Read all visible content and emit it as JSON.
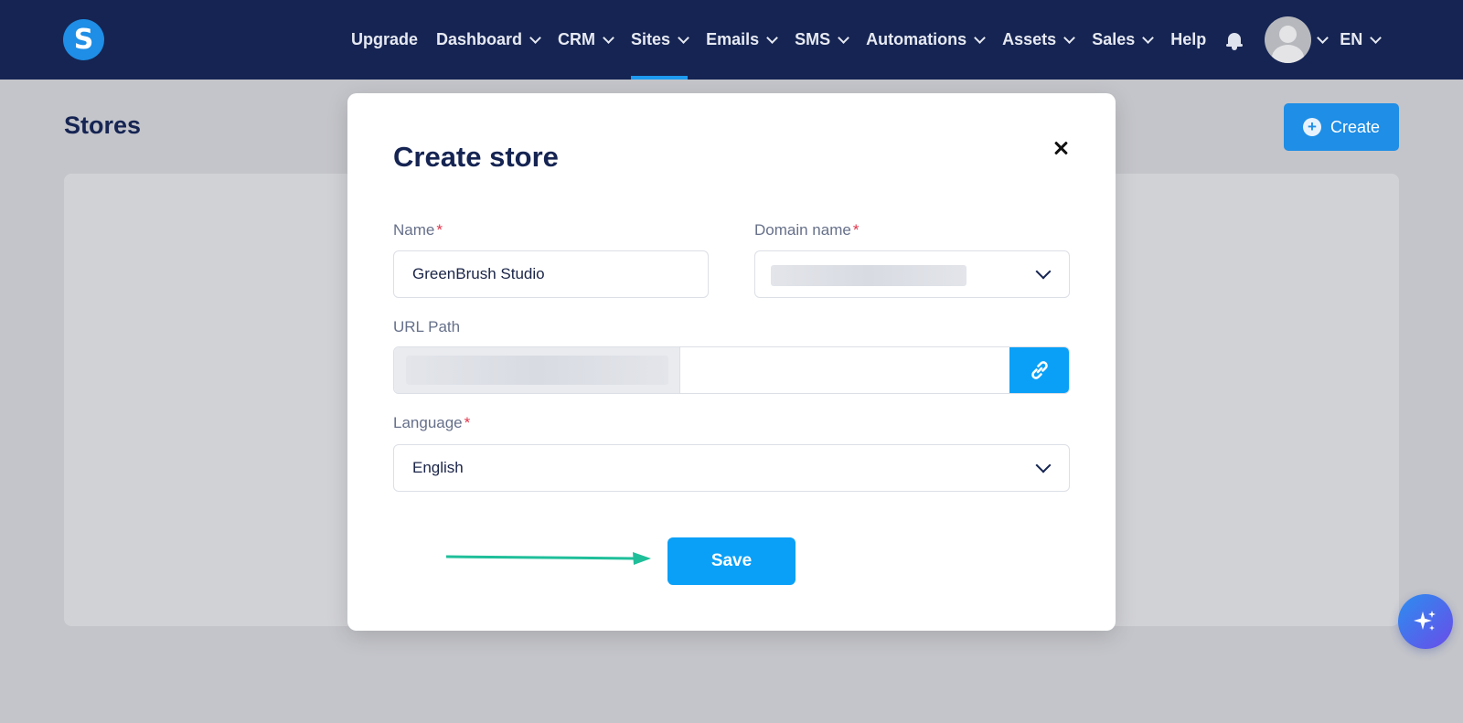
{
  "nav": {
    "logo": "S",
    "items": [
      {
        "label": "Upgrade",
        "dropdown": false,
        "active": false
      },
      {
        "label": "Dashboard",
        "dropdown": true,
        "active": false
      },
      {
        "label": "CRM",
        "dropdown": true,
        "active": false
      },
      {
        "label": "Sites",
        "dropdown": true,
        "active": true
      },
      {
        "label": "Emails",
        "dropdown": true,
        "active": false
      },
      {
        "label": "SMS",
        "dropdown": true,
        "active": false
      },
      {
        "label": "Automations",
        "dropdown": true,
        "active": false
      },
      {
        "label": "Assets",
        "dropdown": true,
        "active": false
      },
      {
        "label": "Sales",
        "dropdown": true,
        "active": false
      },
      {
        "label": "Help",
        "dropdown": false,
        "active": false
      }
    ],
    "language": "EN",
    "colors": {
      "background": "#152452",
      "active_underline": "#1e9af0"
    }
  },
  "page": {
    "title": "Stores",
    "create_button": "Create"
  },
  "modal": {
    "title": "Create store",
    "name_label": "Name",
    "name_value": "GreenBrush Studio",
    "domain_label": "Domain name",
    "url_path_label": "URL Path",
    "language_label": "Language",
    "language_value": "English",
    "required_marker": "*",
    "save_button": "Save"
  },
  "colors": {
    "primary": "#0aa0f7",
    "accent_arrow": "#1fbf9a",
    "required": "#e0364c"
  }
}
